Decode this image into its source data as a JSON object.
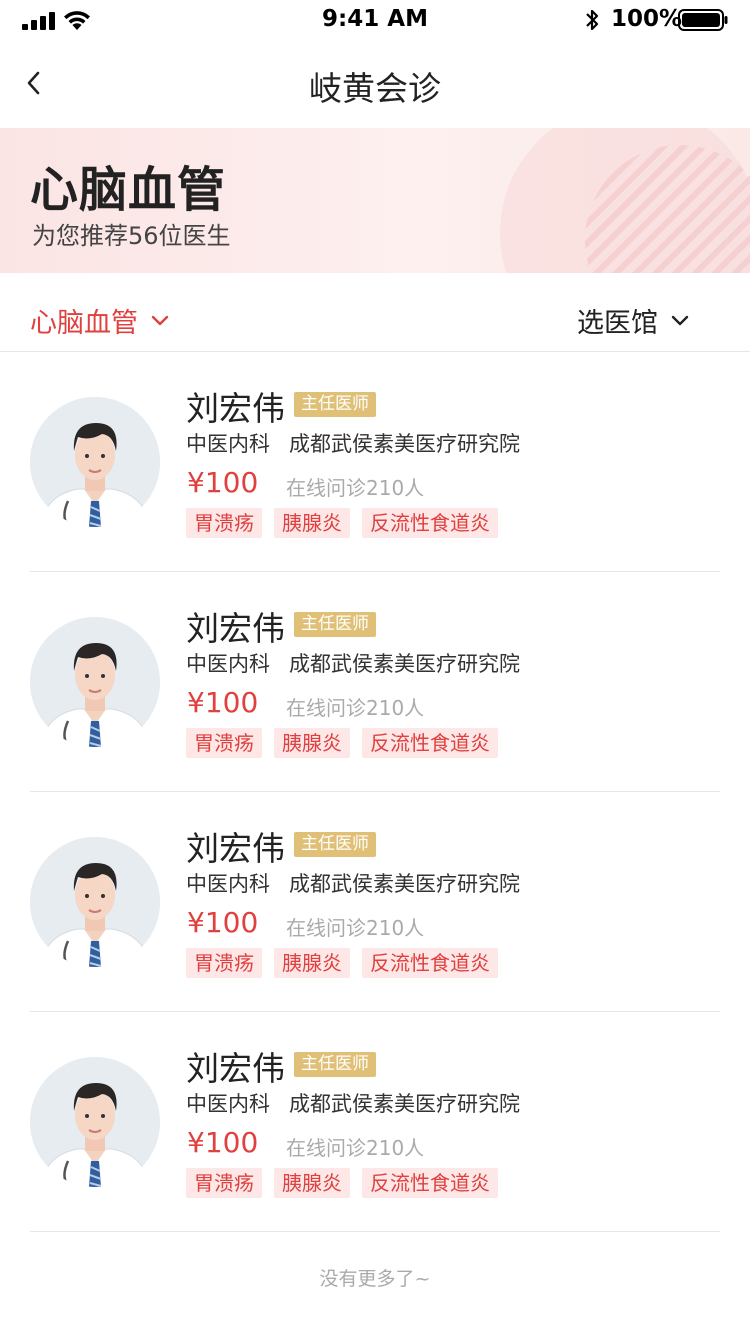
{
  "status_bar": {
    "time": "9:41 AM",
    "battery_percent": "100%"
  },
  "nav": {
    "title": "岐黄会诊"
  },
  "banner": {
    "title": "心脑血管",
    "subtitle": "为您推荐56位医生"
  },
  "filters": {
    "category": "心脑血管",
    "hospital": "选医馆"
  },
  "doctors": [
    {
      "name": "刘宏伟",
      "title": "主任医师",
      "department": "中医内科",
      "hospital": "成都武侯素美医疗研究院",
      "price": "¥100",
      "consultations": "在线问诊210人",
      "tags": [
        "胃溃疡",
        "胰腺炎",
        "反流性食道炎"
      ]
    },
    {
      "name": "刘宏伟",
      "title": "主任医师",
      "department": "中医内科",
      "hospital": "成都武侯素美医疗研究院",
      "price": "¥100",
      "consultations": "在线问诊210人",
      "tags": [
        "胃溃疡",
        "胰腺炎",
        "反流性食道炎"
      ]
    },
    {
      "name": "刘宏伟",
      "title": "主任医师",
      "department": "中医内科",
      "hospital": "成都武侯素美医疗研究院",
      "price": "¥100",
      "consultations": "在线问诊210人",
      "tags": [
        "胃溃疡",
        "胰腺炎",
        "反流性食道炎"
      ]
    },
    {
      "name": "刘宏伟",
      "title": "主任医师",
      "department": "中医内科",
      "hospital": "成都武侯素美医疗研究院",
      "price": "¥100",
      "consultations": "在线问诊210人",
      "tags": [
        "胃溃疡",
        "胰腺炎",
        "反流性食道炎"
      ]
    }
  ],
  "footer": {
    "no_more": "没有更多了~"
  },
  "colors": {
    "accent": "#e0403e",
    "badge_gold": "#dfc076",
    "tag_bg": "#fde7e7",
    "banner_bg": "#fbe4e4"
  },
  "icons": {
    "back": "chevron-left-icon",
    "dropdown": "chevron-down-icon",
    "avatar": "doctor-avatar"
  }
}
